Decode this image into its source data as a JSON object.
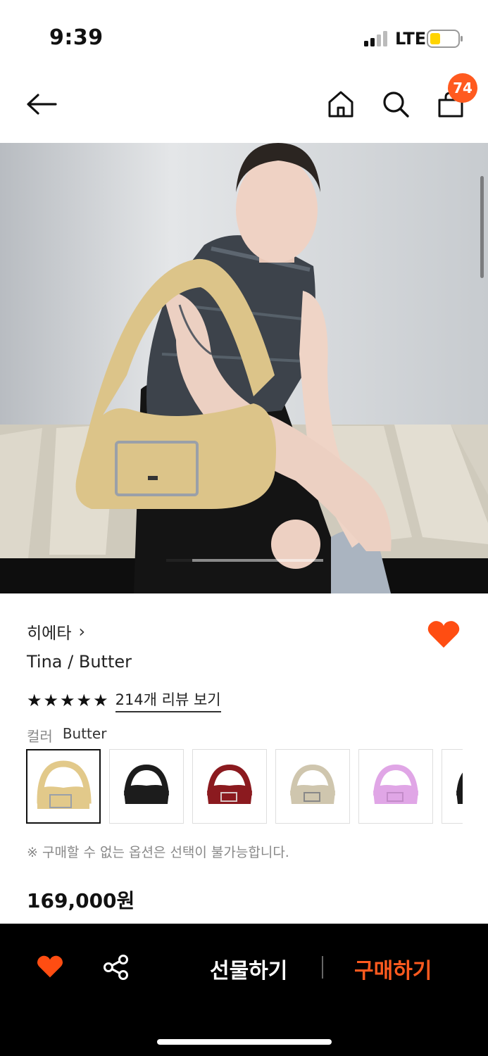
{
  "status_bar": {
    "time": "9:39",
    "network": "LTE"
  },
  "nav": {
    "back_icon": "arrow-left-icon",
    "home_icon": "home-icon",
    "search_icon": "search-icon",
    "cart_icon": "shopping-bag-icon",
    "cart_count": "74"
  },
  "product": {
    "brand": "히에타",
    "brand_chevron": "›",
    "name": "Tina / Butter",
    "rating_stars": 5,
    "review_link": "214개 리뷰 보기",
    "color_label": "컬러",
    "color_value": "Butter",
    "swatches": [
      {
        "name": "Butter",
        "color": "#e2c98a"
      },
      {
        "name": "Black",
        "color": "#1c1c1c"
      },
      {
        "name": "Red",
        "color": "#8b1a1f"
      },
      {
        "name": "Silver",
        "color": "#cfc6ae"
      },
      {
        "name": "Pink",
        "color": "#e0a6e6"
      },
      {
        "name": "Black 2",
        "color": "#1a1a1a"
      }
    ],
    "notice": "※ 구매할 수 없는 옵션은 선택이 불가능합니다.",
    "price": "169,000원"
  },
  "bottom_bar": {
    "gift_label": "선물하기",
    "buy_label": "구매하기"
  },
  "colors": {
    "accent": "#ff5a1f",
    "bar_bg": "#000000"
  }
}
